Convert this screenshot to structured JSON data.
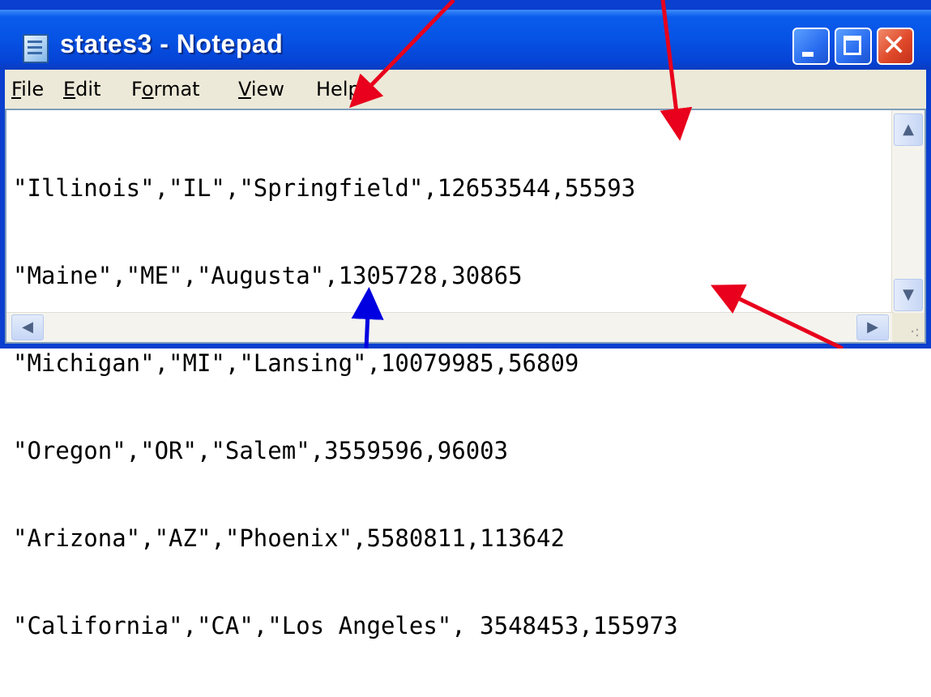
{
  "window": {
    "title": "states3 - Notepad",
    "icons": {
      "app": "notepad-icon",
      "minimize": "minimize-icon",
      "maximize": "maximize-icon",
      "close": "close-icon"
    }
  },
  "menu": {
    "file": {
      "mnemonic": "F",
      "rest": "ile"
    },
    "edit": {
      "mnemonic": "E",
      "rest": "dit"
    },
    "format": {
      "pre": "F",
      "mnemonic": "o",
      "rest": "rmat"
    },
    "view": {
      "mnemonic": "V",
      "rest": "iew"
    },
    "help": {
      "pre": "Hel",
      "mnemonic": "p",
      "rest": ""
    }
  },
  "document": {
    "lines": [
      "\"Illinois\",\"IL\",\"Springfield\",12653544,55593",
      "\"Maine\",\"ME\",\"Augusta\",1305728,30865",
      "\"Michigan\",\"MI\",\"Lansing\",10079985,56809",
      "\"Oregon\",\"OR\",\"Salem\",3559596,96003",
      "\"Arizona\",\"AZ\",\"Phoenix\",5580811,113642",
      "\"California\",\"CA\",\"Los Angeles\", 3548453,155973"
    ]
  },
  "scrollbars": {
    "up": "▲",
    "down": "▼",
    "left": "◀",
    "right": "▶"
  },
  "annotation_colors": {
    "red_arrow": "#e8001c",
    "blue_arrow": "#0000e0"
  }
}
